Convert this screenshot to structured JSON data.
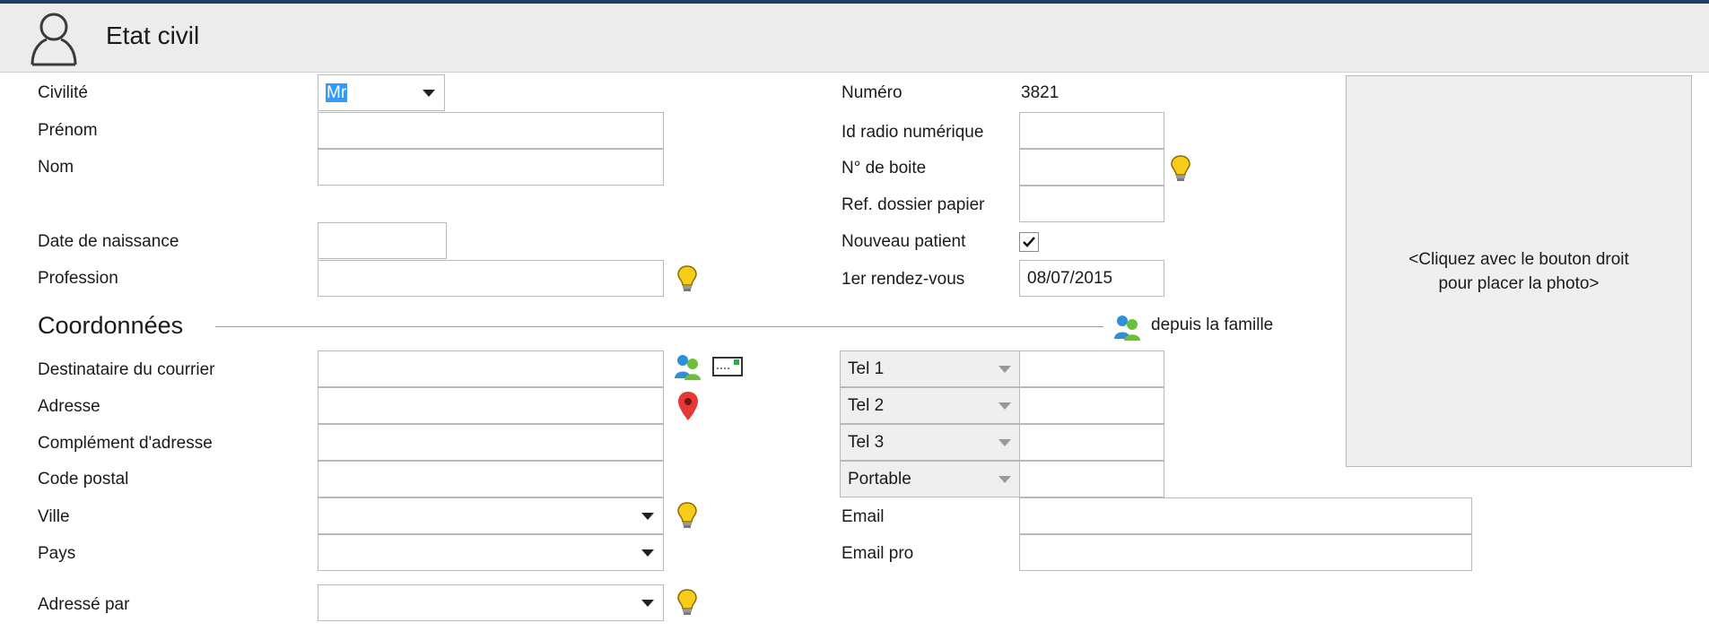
{
  "header": {
    "title": "Etat civil",
    "icon": "user-icon"
  },
  "etat_civil": {
    "civilite": {
      "label": "Civilité",
      "value": "Mr"
    },
    "prenom": {
      "label": "Prénom",
      "value": ""
    },
    "nom": {
      "label": "Nom",
      "value": ""
    },
    "date_naissance": {
      "label": "Date de naissance",
      "value": ""
    },
    "profession": {
      "label": "Profession",
      "value": ""
    }
  },
  "dossier": {
    "numero": {
      "label": "Numéro",
      "value": "3821"
    },
    "id_radio": {
      "label": "Id radio numérique",
      "value": ""
    },
    "no_boite": {
      "label": "N° de boite",
      "value": ""
    },
    "ref_dossier": {
      "label": "Ref. dossier papier",
      "value": ""
    },
    "nouveau_patient": {
      "label": "Nouveau patient",
      "checked": true
    },
    "premier_rdv": {
      "label": "1er rendez-vous",
      "value": "08/07/2015"
    }
  },
  "photo": {
    "line1": "<Cliquez avec le bouton droit",
    "line2": "pour placer la photo>"
  },
  "coordonnees": {
    "section_title": "Coordonnées",
    "depuis_famille": "depuis la famille",
    "destinataire": {
      "label": "Destinataire du courrier",
      "value": ""
    },
    "adresse": {
      "label": "Adresse",
      "value": ""
    },
    "complement": {
      "label": "Complément d'adresse",
      "value": ""
    },
    "code_postal": {
      "label": "Code postal",
      "value": ""
    },
    "ville": {
      "label": "Ville",
      "value": ""
    },
    "pays": {
      "label": "Pays",
      "value": ""
    },
    "adresse_par": {
      "label": "Adressé par",
      "value": ""
    }
  },
  "phones": [
    {
      "type": "Tel 1",
      "value": ""
    },
    {
      "type": "Tel 2",
      "value": ""
    },
    {
      "type": "Tel 3",
      "value": ""
    },
    {
      "type": "Portable",
      "value": ""
    }
  ],
  "email": {
    "label": "Email",
    "value": ""
  },
  "email_pro": {
    "label": "Email pro",
    "value": ""
  },
  "colors": {
    "accent": "#3399ff",
    "header_bg": "#ececec",
    "top_bar": "#1f3e66",
    "bulb": "#f2c200",
    "pin": "#e53935"
  }
}
